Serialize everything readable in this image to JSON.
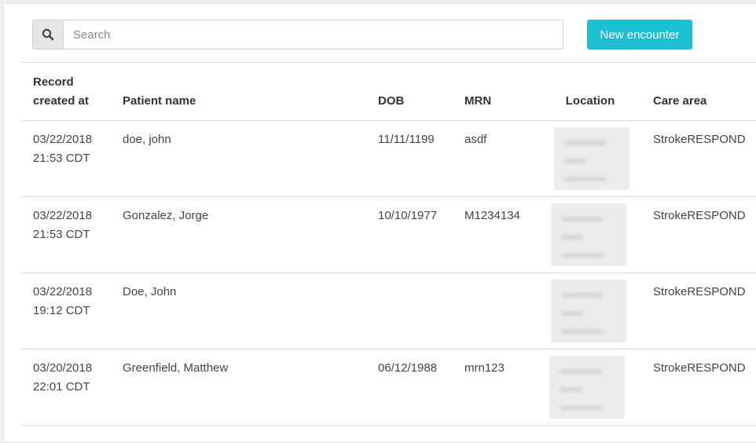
{
  "search": {
    "placeholder": "Search"
  },
  "toolbar": {
    "new_encounter_label": "New encounter"
  },
  "table": {
    "headers": {
      "record_line1": "Record",
      "record_line2": "created at",
      "patient_name": "Patient name",
      "dob": "DOB",
      "mrn": "MRN",
      "location": "Location",
      "care_area": "Care area"
    },
    "rows": [
      {
        "date": "03/22/2018",
        "time": "21:53 CDT",
        "name": "doe, john",
        "dob": "11/11/1199",
        "mrn": "asdf",
        "care_area": "StrokeRESPOND"
      },
      {
        "date": "03/22/2018",
        "time": "21:53 CDT",
        "name": "Gonzalez, Jorge",
        "dob": "10/10/1977",
        "mrn": "M1234134",
        "care_area": "StrokeRESPOND"
      },
      {
        "date": "03/22/2018",
        "time": "19:12 CDT",
        "name": "Doe, John",
        "dob": "",
        "mrn": "",
        "care_area": "StrokeRESPOND"
      },
      {
        "date": "03/20/2018",
        "time": "22:01 CDT",
        "name": "Greenfield, Matthew",
        "dob": "06/12/1988",
        "mrn": "mrn123",
        "care_area": "StrokeRESPOND"
      }
    ]
  }
}
